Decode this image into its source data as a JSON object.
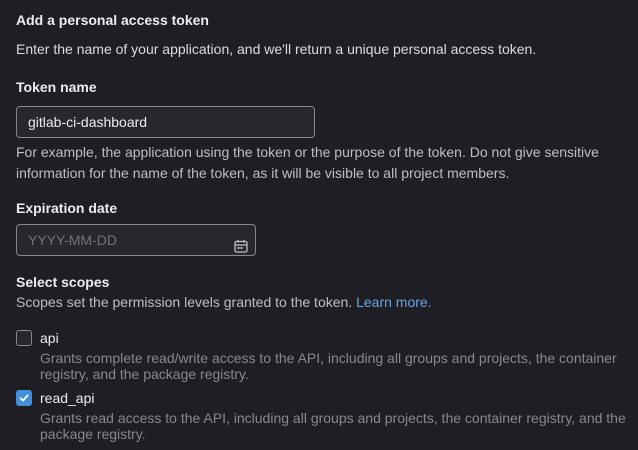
{
  "section": {
    "title": "Add a personal access token",
    "intro": "Enter the name of your application, and we'll return a unique personal access token."
  },
  "token_name": {
    "label": "Token name",
    "value": "gitlab-ci-dashboard",
    "help": "For example, the application using the token or the purpose of the token. Do not give sensitive information for the name of the token, as it will be visible to all project members."
  },
  "expiration": {
    "label": "Expiration date",
    "placeholder": "YYYY-MM-DD",
    "icon": "calendar-icon"
  },
  "scopes": {
    "label": "Select scopes",
    "help": "Scopes set the permission levels granted to the token.",
    "learn_more": "Learn more.",
    "items": [
      {
        "name": "api",
        "checked": false,
        "description": "Grants complete read/write access to the API, including all groups and projects, the container registry, and the package registry."
      },
      {
        "name": "read_api",
        "checked": true,
        "description": "Grants read access to the API, including all groups and projects, the container registry, and the package registry."
      }
    ]
  },
  "colors": {
    "background": "#1f1e24",
    "input_background": "#28272d",
    "accent": "#428fdc",
    "link": "#63a6e9"
  }
}
